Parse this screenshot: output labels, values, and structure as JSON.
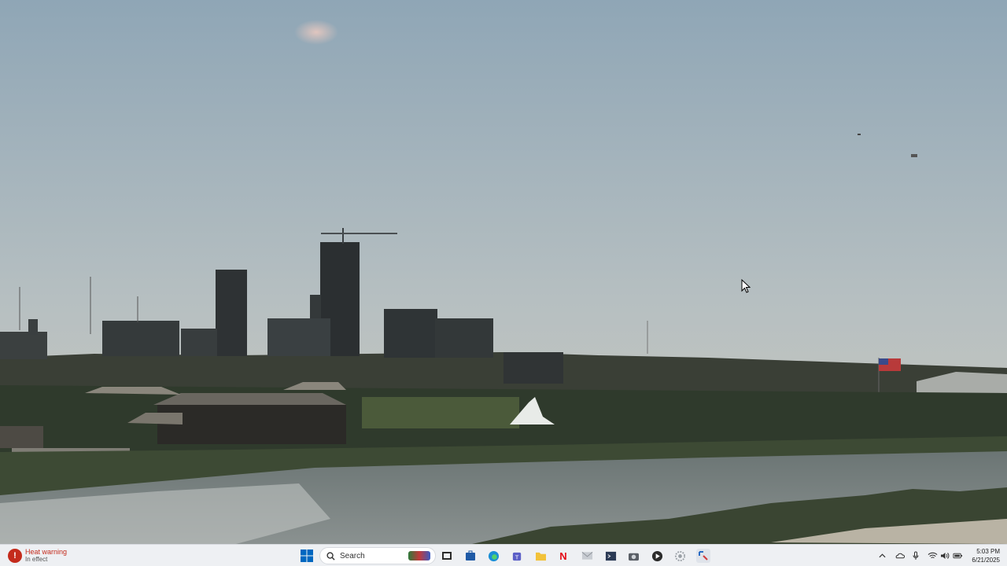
{
  "desktop": {
    "wallpaper": "city skyline with river",
    "colors": {
      "sky_top": "#8fa6b6",
      "sky_bottom": "#c4c7bf",
      "river": "#6f7a78",
      "accent": "#0067c0"
    }
  },
  "taskbar": {
    "widget": {
      "title": "Heat warning",
      "subtitle": "In effect",
      "icon": "heat-warning-icon"
    },
    "search": {
      "placeholder": "Search",
      "icon": "search-icon"
    },
    "pinned": [
      {
        "name": "start-button",
        "icon": "windows-logo-icon"
      },
      {
        "name": "taskview-button",
        "icon": "task-view-icon"
      },
      {
        "name": "app-store",
        "icon": "store-icon"
      },
      {
        "name": "app-edge",
        "icon": "edge-icon"
      },
      {
        "name": "app-teams",
        "icon": "teams-icon"
      },
      {
        "name": "app-explorer",
        "icon": "folder-icon"
      },
      {
        "name": "app-netflix",
        "icon": "netflix-icon",
        "glyph": "N"
      },
      {
        "name": "app-mail",
        "icon": "mail-icon"
      },
      {
        "name": "app-terminal",
        "icon": "terminal-icon"
      },
      {
        "name": "app-camera",
        "icon": "camera-icon"
      },
      {
        "name": "app-media",
        "icon": "media-player-icon"
      },
      {
        "name": "app-gear",
        "icon": "settings-icon"
      },
      {
        "name": "app-snip",
        "icon": "snipping-tool-icon"
      }
    ],
    "tray": {
      "chevron": "chevron-up-icon",
      "cloud": "onedrive-icon",
      "mic": "microphone-icon",
      "wifi": "wifi-icon",
      "volume": "volume-icon",
      "battery": "battery-icon"
    },
    "clock": {
      "time": "5:03 PM",
      "date": "6/21/2025"
    }
  }
}
